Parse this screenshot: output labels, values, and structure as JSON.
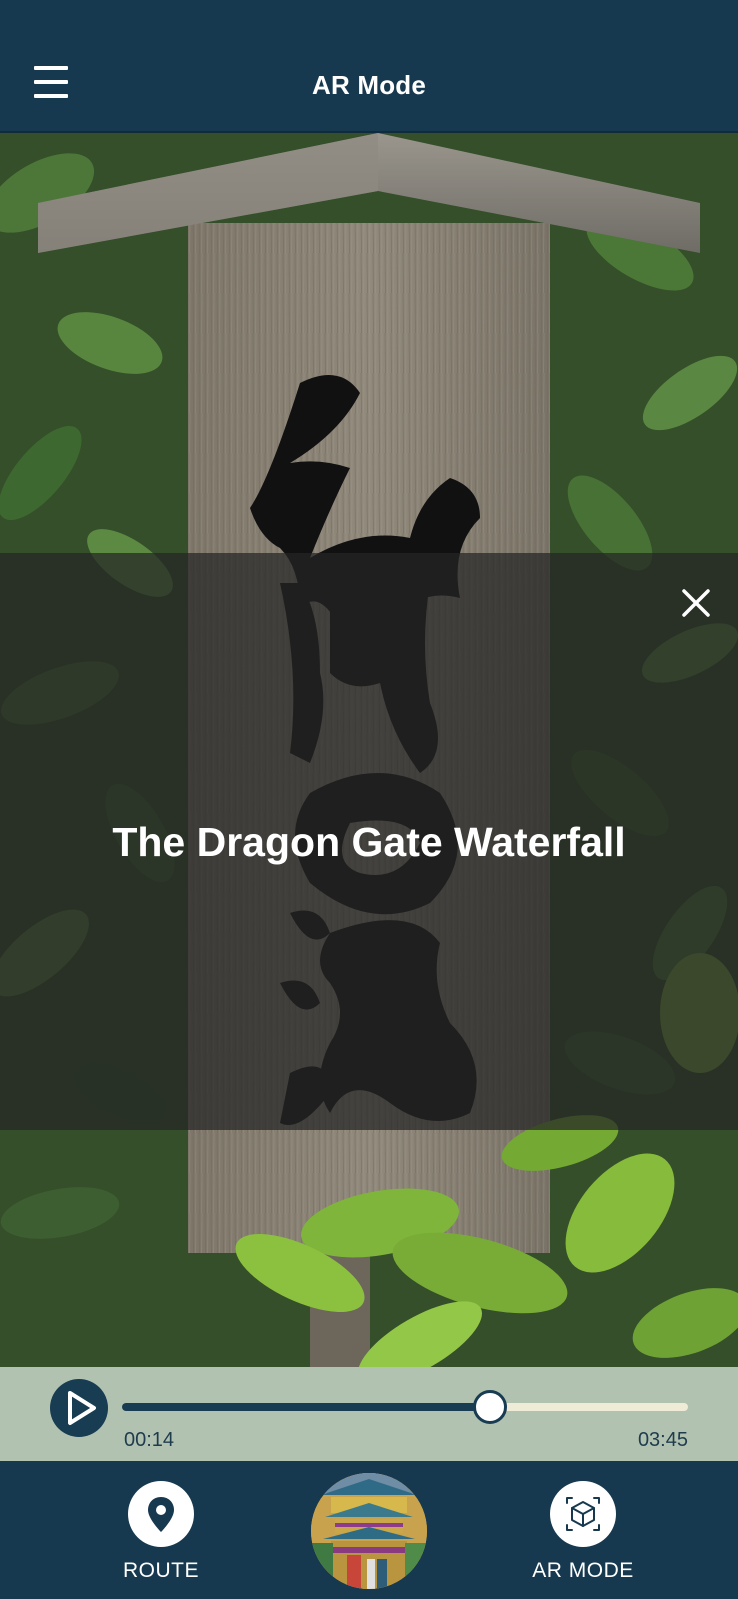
{
  "header": {
    "title": "AR Mode",
    "menu_icon": "hamburger-menu-icon"
  },
  "camera": {
    "sign_text": "龍門の瀧"
  },
  "overlay": {
    "title": "The Dragon Gate Waterfall",
    "close_icon": "close-icon"
  },
  "player": {
    "current_time": "00:14",
    "total_time": "03:45",
    "progress_fraction": 0.65,
    "play_icon": "play-icon"
  },
  "bottom_nav": {
    "route_label": "ROUTE",
    "route_icon": "map-pin-icon",
    "ar_label": "AR MODE",
    "ar_icon": "ar-cube-icon",
    "center_icon": "temple-painting-thumbnail"
  },
  "colors": {
    "primary": "#17394f",
    "player_bg": "#b2c2b0",
    "track": "#efebd6"
  }
}
